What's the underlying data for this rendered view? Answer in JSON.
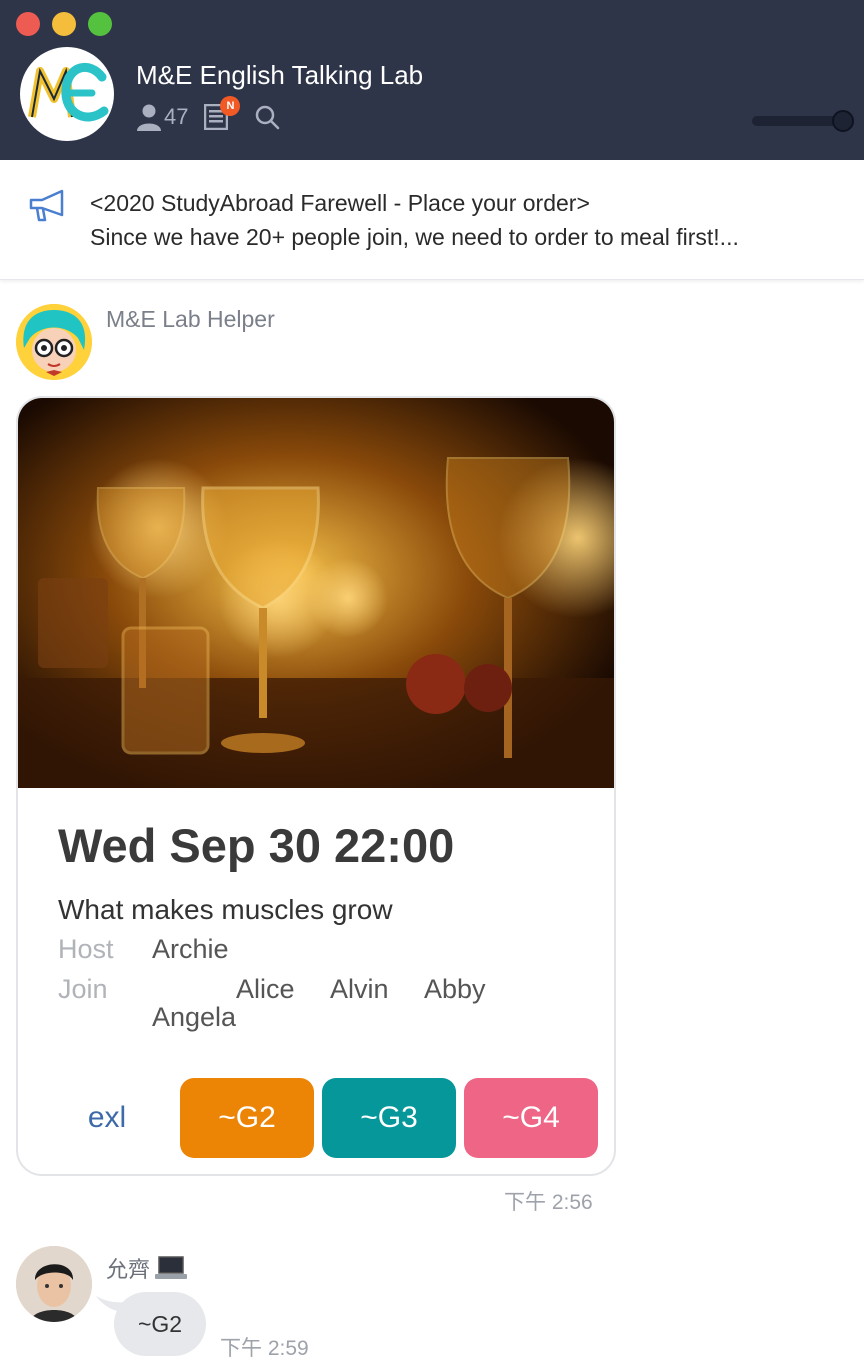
{
  "window": {
    "group_title": "M&E English Talking Lab",
    "member_count": "47",
    "notes_badge": "N"
  },
  "announcement": {
    "title": "<2020 StudyAbroad Farewell - Place your order>",
    "body": "Since we have 20+ people join, we need to order to meal first!..."
  },
  "messages": [
    {
      "sender": "M&E Lab Helper",
      "card": {
        "date": "Wed Sep 30 22:00",
        "topic": "What makes muscles grow",
        "host_label": "Host",
        "host": "Archie",
        "join_label": "Join",
        "joiners": [
          "Alice",
          "Alvin",
          "Abby",
          "Angela"
        ],
        "buttons": [
          "exl",
          "~G2",
          "~G3",
          "~G4"
        ]
      },
      "time": "下午 2:56"
    },
    {
      "sender": "允齊",
      "text": "~G2",
      "time": "下午 2:59"
    }
  ],
  "colors": {
    "header": "#2e3549",
    "g2": "#ec8406",
    "g3": "#06979a",
    "g4": "#ee6586",
    "link": "#3d6aa8"
  }
}
